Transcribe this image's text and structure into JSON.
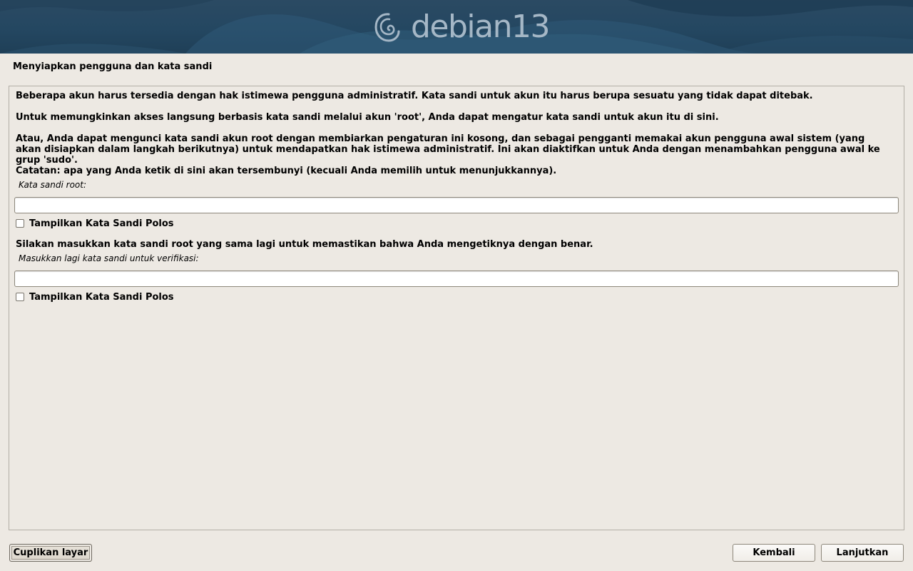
{
  "banner": {
    "brand": "debian",
    "version": "13",
    "logo_icon": "debian-swirl-icon",
    "colors": {
      "banner_bg": "#244761",
      "logo_text": "#a5b7c6"
    }
  },
  "step": {
    "title": "Menyiapkan pengguna dan kata sandi"
  },
  "content": {
    "paragraphs": [
      "Beberapa akun harus tersedia dengan hak istimewa pengguna administratif. Kata sandi untuk akun itu harus berupa sesuatu yang tidak dapat ditebak.",
      "Untuk memungkinkan akses langsung berbasis kata sandi melalui akun 'root', Anda dapat mengatur kata sandi untuk akun itu di sini.",
      "Atau, Anda dapat mengunci kata sandi akun root dengan membiarkan pengaturan ini kosong, dan sebagai pengganti memakai akun pengguna awal sistem (yang akan disiapkan dalam langkah berikutnya) untuk mendapatkan hak istimewa administratif. Ini akan diaktifkan untuk Anda dengan menambahkan pengguna awal ke grup 'sudo'.",
      "Catatan: apa yang Anda ketik di sini akan tersembunyi (kecuali Anda memilih untuk menunjukkannya)."
    ],
    "root_password": {
      "label": "Kata sandi root:",
      "value": "",
      "show_plain_label": "Tampilkan Kata Sandi Polos",
      "show_plain_checked": false
    },
    "verify_prompt": "Silakan masukkan kata sandi root yang sama lagi untuk memastikan bahwa Anda mengetiknya dengan benar.",
    "verify_password": {
      "label": "Masukkan lagi kata sandi untuk verifikasi:",
      "value": "",
      "show_plain_label": "Tampilkan Kata Sandi Polos",
      "show_plain_checked": false
    }
  },
  "buttons": {
    "screenshot": "Cuplikan layar",
    "back": "Kembali",
    "next": "Lanjutkan"
  }
}
